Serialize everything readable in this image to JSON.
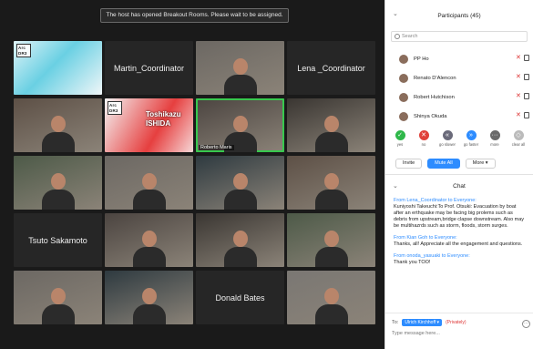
{
  "banner": "The host has opened Breakout Rooms. Please wait to be assigned.",
  "tiles": [
    {
      "kind": "slide",
      "logo": "Arc DR3",
      "caption": ""
    },
    {
      "kind": "name",
      "name": "Martin_Coordinator"
    },
    {
      "kind": "video",
      "caption": ""
    },
    {
      "kind": "name",
      "name": "Lena _Coordinator"
    },
    {
      "kind": "video",
      "caption": ""
    },
    {
      "kind": "slide",
      "logo": "Arc DR3",
      "overlay": "Toshikazu ISHIDA"
    },
    {
      "kind": "video",
      "caption": "Roberto Maris",
      "active": true
    },
    {
      "kind": "video",
      "caption": ""
    },
    {
      "kind": "video",
      "caption": ""
    },
    {
      "kind": "video",
      "caption": ""
    },
    {
      "kind": "video",
      "caption": ""
    },
    {
      "kind": "video",
      "caption": ""
    },
    {
      "kind": "name",
      "name": "Tsuto Sakamoto"
    },
    {
      "kind": "video",
      "caption": ""
    },
    {
      "kind": "video",
      "caption": ""
    },
    {
      "kind": "video",
      "caption": ""
    },
    {
      "kind": "video",
      "caption": ""
    },
    {
      "kind": "video",
      "caption": ""
    },
    {
      "kind": "name",
      "name": "Donald Bates"
    },
    {
      "kind": "video",
      "caption": ""
    }
  ],
  "sidebar": {
    "participants_title": "Participants (45)",
    "search_placeholder": "Search",
    "participants": [
      {
        "name": "PP Ho"
      },
      {
        "name": "Renato D'Alencon"
      },
      {
        "name": "Robert Hutchison"
      },
      {
        "name": "Shinya Okuda"
      }
    ],
    "reactions": [
      {
        "label": "yes",
        "symbol": "✓",
        "color": "#2fb84a"
      },
      {
        "label": "no",
        "symbol": "✕",
        "color": "#e0413a"
      },
      {
        "label": "go slower",
        "symbol": "«",
        "color": "#6a6a7a"
      },
      {
        "label": "go faster",
        "symbol": "»",
        "color": "#2d8cff"
      },
      {
        "label": "more",
        "symbol": "···",
        "color": "#6a6a6a"
      },
      {
        "label": "clear all",
        "symbol": "◇",
        "color": "#bbbbbb"
      }
    ],
    "actions": {
      "invite": "Invite",
      "mute_all": "Mute All",
      "more": "More ▾"
    },
    "chat_title": "Chat",
    "messages": [
      {
        "from": "From Lena_Coordinator to Everyone:",
        "text": "Kuniyoshi Takeuchi:To Prof. Otsuki: Evacuation by boat after an erthquake may be facing big prolems such as debris from upstream,bridge clapse downstream. Also may be multihazrds such as storm, floods, storm surges."
      },
      {
        "from": "From Kian Goh to Everyone:",
        "text": "Thanks, all! Appreciate all the engagement and questions."
      },
      {
        "from": "From onoda_yasuaki to Everyone:",
        "text": "Thank you TOO!"
      }
    ],
    "to_label": "To:",
    "recipient": "Ulrich Kirchhoff ▾",
    "privately": "(Privately)",
    "input_placeholder": "Type message here..."
  }
}
